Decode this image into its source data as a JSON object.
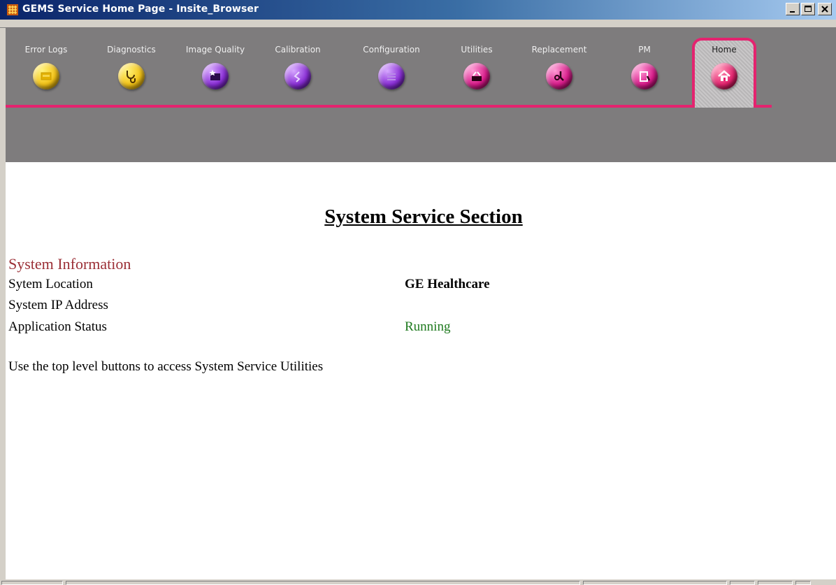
{
  "window": {
    "title": "GEMS Service Home Page - Insite_Browser",
    "icon": "gems-app-icon",
    "controls": [
      "minimize-icon",
      "maximize-icon",
      "close-icon"
    ]
  },
  "nav": {
    "items": [
      {
        "label": "Error Logs",
        "icon": "error-log-icon",
        "color": "#f3c318"
      },
      {
        "label": "Diagnostics",
        "icon": "stethoscope-icon",
        "color": "#f3c318"
      },
      {
        "label": "Image Quality",
        "icon": "image-quality-icon",
        "color": "#8a2fd6"
      },
      {
        "label": "Calibration",
        "icon": "calibration-icon",
        "color": "#8a2fd6"
      },
      {
        "label": "Configuration",
        "icon": "configuration-icon",
        "color": "#8a2fd6"
      },
      {
        "label": "Utilities",
        "icon": "utilities-icon",
        "color": "#d81b8a"
      },
      {
        "label": "Replacement",
        "icon": "replacement-icon",
        "color": "#d81b8a"
      },
      {
        "label": "PM",
        "icon": "pm-icon",
        "color": "#d81b8a"
      },
      {
        "label": "Home",
        "icon": "home-icon",
        "color": "#e4236f",
        "selected": true
      }
    ]
  },
  "main": {
    "heading": "System Service Section",
    "section_title": "System Information",
    "rows": [
      {
        "label": "Sytem Location",
        "value": "GE Healthcare"
      },
      {
        "label": "System IP Address",
        "value": ""
      },
      {
        "label": "Application Status",
        "value": "Running"
      }
    ],
    "note": "Use the top level buttons to access System Service Utilities"
  },
  "colors": {
    "accent": "#e4236f",
    "toolbar_bg": "#7e7c7d",
    "section_title": "#9b2f36",
    "status_running": "#1f7a1f"
  }
}
